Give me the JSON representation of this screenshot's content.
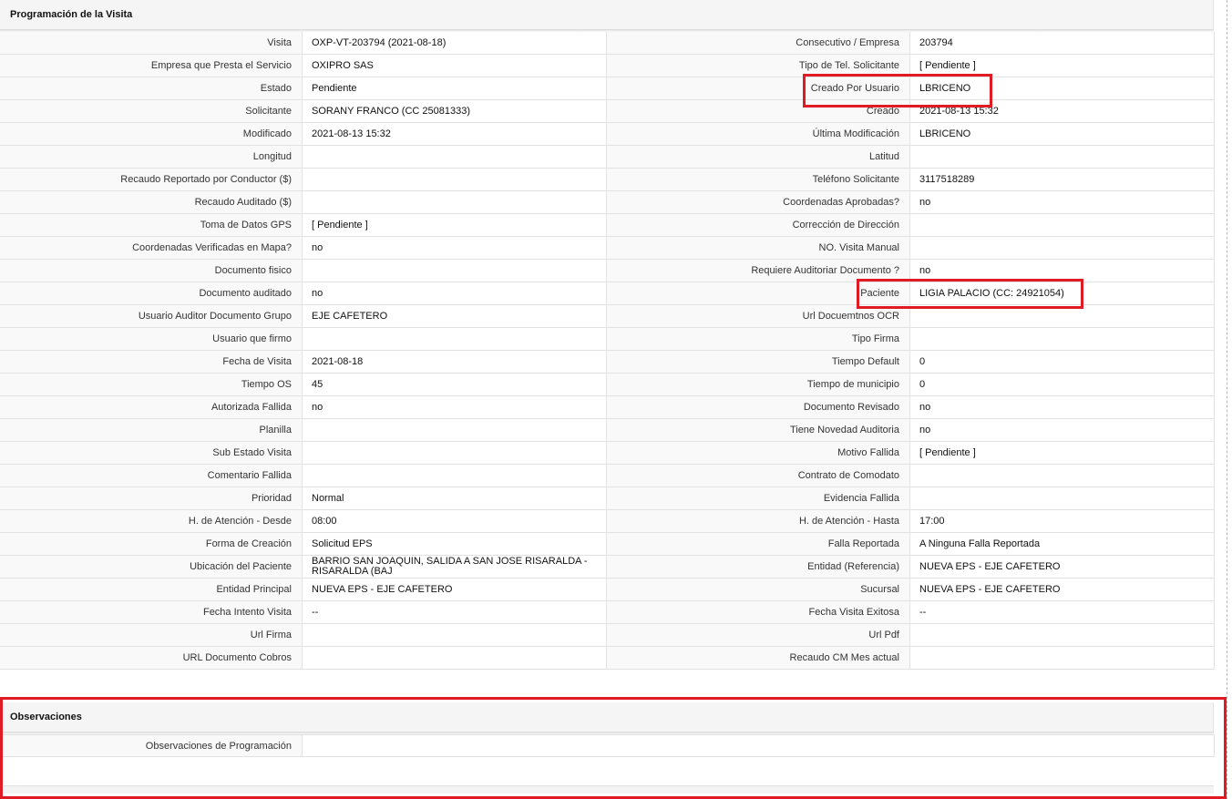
{
  "section_title": "Programación de la Visita",
  "rows": [
    {
      "l1": "Visita",
      "v1": "OXP-VT-203794 (2021-08-18)",
      "l2": "Consecutivo / Empresa",
      "v2": "203794"
    },
    {
      "l1": "Empresa que Presta el Servicio",
      "v1": "OXIPRO SAS",
      "l2": "Tipo de Tel. Solicitante",
      "v2": "[ Pendiente ]"
    },
    {
      "l1": "Estado",
      "v1": "Pendiente",
      "l2": "Creado Por Usuario",
      "v2": "LBRICENO"
    },
    {
      "l1": "Solicitante",
      "v1": "SORANY FRANCO (CC 25081333)",
      "l2": "Creado",
      "v2": "2021-08-13 15:32"
    },
    {
      "l1": "Modificado",
      "v1": "2021-08-13 15:32",
      "l2": "Última Modificación",
      "v2": " LBRICENO"
    },
    {
      "l1": "Longitud",
      "v1": "",
      "l2": "Latitud",
      "v2": ""
    },
    {
      "l1": "Recaudo Reportado por Conductor ($)",
      "v1": "",
      "l2": "Teléfono Solicitante",
      "v2": "3117518289"
    },
    {
      "l1": "Recaudo Auditado ($)",
      "v1": "",
      "l2": "Coordenadas Aprobadas?",
      "v2": " no"
    },
    {
      "l1": "Toma de Datos GPS",
      "v1": "[ Pendiente ]",
      "l2": "Corrección de Dirección",
      "v2": ""
    },
    {
      "l1": "Coordenadas Verificadas en Mapa?",
      "v1": " no",
      "l2": "NO. Visita Manual",
      "v2": ""
    },
    {
      "l1": "Documento fisico",
      "v1": "",
      "l2": "Requiere Auditoriar Documento ?",
      "v2": " no"
    },
    {
      "l1": "Documento auditado",
      "v1": " no",
      "l2": "Paciente",
      "v2": "LIGIA PALACIO (CC: 24921054)"
    },
    {
      "l1": "Usuario Auditor Documento Grupo",
      "v1": "EJE CAFETERO",
      "l2": "Url Docuemtnos OCR",
      "v2": ""
    },
    {
      "l1": "Usuario que firmo",
      "v1": "",
      "l2": "Tipo Firma",
      "v2": ""
    },
    {
      "l1": "Fecha de Visita",
      "v1": " 2021-08-18",
      "l2": "Tiempo Default",
      "v2": "0"
    },
    {
      "l1": "Tiempo OS",
      "v1": "45",
      "l2": "Tiempo de municipio",
      "v2": "0"
    },
    {
      "l1": "Autorizada Fallida",
      "v1": " no",
      "l2": "Documento Revisado",
      "v2": " no"
    },
    {
      "l1": "Planilla",
      "v1": "",
      "l2": "Tiene Novedad Auditoria",
      "v2": " no"
    },
    {
      "l1": "Sub Estado Visita",
      "v1": "",
      "l2": "Motivo Fallida",
      "v2": "[ Pendiente ]"
    },
    {
      "l1": "Comentario Fallida",
      "v1": "",
      "l2": "Contrato de Comodato",
      "v2": ""
    },
    {
      "l1": "Prioridad",
      "v1": "Normal",
      "l2": "Evidencia Fallida",
      "v2": ""
    },
    {
      "l1": "H. de Atención - Desde",
      "v1": "08:00",
      "l2": "H. de Atención - Hasta",
      "v2": "17:00"
    },
    {
      "l1": "Forma de Creación",
      "v1": "Solicitud EPS",
      "l2": "Falla Reportada",
      "v2": "A Ninguna Falla Reportada"
    },
    {
      "l1": "Ubicación del Paciente",
      "v1": "BARRIO SAN JOAQUIN, SALIDA A SAN JOSE RISARALDA - RISARALDA (BAJ",
      "l2": "Entidad (Referencia)",
      "v2": "NUEVA EPS - EJE CAFETERO"
    },
    {
      "l1": "Entidad Principal",
      "v1": "NUEVA EPS - EJE CAFETERO",
      "l2": "Sucursal",
      "v2": "NUEVA EPS - EJE CAFETERO"
    },
    {
      "l1": "Fecha Intento Visita",
      "v1": " --",
      "l2": "Fecha Visita Exitosa",
      "v2": " --"
    },
    {
      "l1": "Url Firma",
      "v1": "",
      "l2": "Url Pdf",
      "v2": ""
    },
    {
      "l1": "URL Documento Cobros",
      "v1": "",
      "l2": "Recaudo CM Mes actual",
      "v2": ""
    }
  ],
  "observaciones": {
    "title": "Observaciones",
    "label": "Observaciones de Programación",
    "value": ""
  },
  "highlight_color": "#e01b24"
}
